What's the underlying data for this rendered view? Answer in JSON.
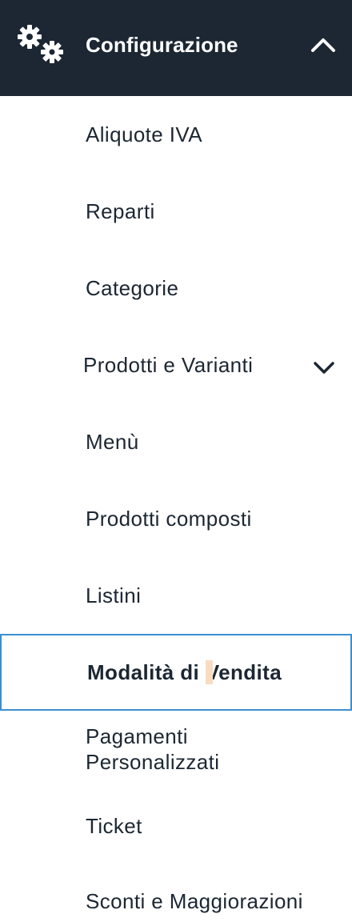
{
  "header": {
    "title": "Configurazione",
    "icon": "gears-icon",
    "toggle_icon": "chevron-up-icon",
    "background": "#1c2733"
  },
  "menu": {
    "items": [
      {
        "label": "Aliquote IVA"
      },
      {
        "label": "Reparti"
      },
      {
        "label": "Categorie"
      },
      {
        "label": "Prodotti e Varianti",
        "expand_icon": "chevron-down-icon"
      },
      {
        "label": "Menù"
      },
      {
        "label": "Prodotti composti"
      },
      {
        "label": "Listini"
      },
      {
        "label_part1": "Modalità di",
        "label_part2": "Vendita",
        "selected": true
      },
      {
        "label_line1": "Pagamenti",
        "label_line2": "Personalizzati"
      },
      {
        "label": "Ticket"
      },
      {
        "label": "Sconti e Maggiorazioni"
      }
    ]
  },
  "colors": {
    "accent_border": "#3b8fd0",
    "text": "#1c2733",
    "caret_highlight": "#f8dcc2"
  }
}
